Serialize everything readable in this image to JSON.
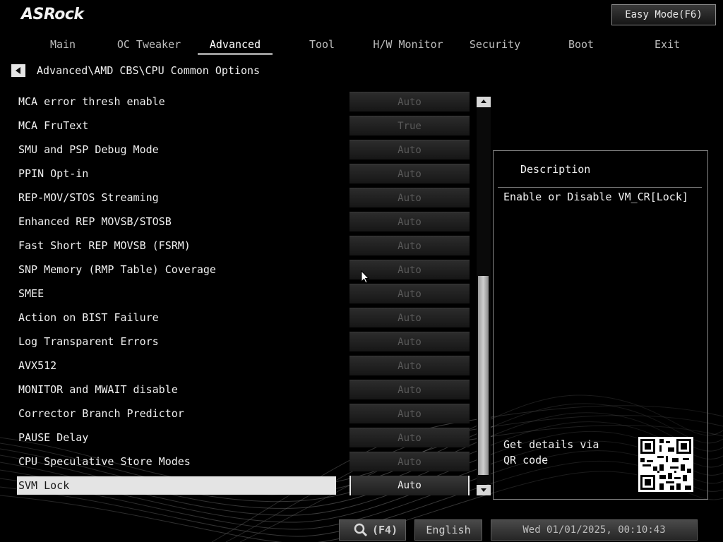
{
  "brand": {
    "logo": "ASRock"
  },
  "header": {
    "easy_mode": "Easy Mode(F6)"
  },
  "tabs": [
    {
      "label": "Main"
    },
    {
      "label": "OC Tweaker"
    },
    {
      "label": "Advanced",
      "active": true
    },
    {
      "label": "Tool"
    },
    {
      "label": "H/W Monitor"
    },
    {
      "label": "Security"
    },
    {
      "label": "Boot"
    },
    {
      "label": "Exit"
    }
  ],
  "breadcrumb": "Advanced\\AMD CBS\\CPU Common Options",
  "settings": [
    {
      "label": "MCA error thresh enable",
      "value": "Auto"
    },
    {
      "label": "MCA FruText",
      "value": "True"
    },
    {
      "label": "SMU and PSP Debug Mode",
      "value": "Auto"
    },
    {
      "label": "PPIN Opt-in",
      "value": "Auto"
    },
    {
      "label": "REP-MOV/STOS Streaming",
      "value": "Auto"
    },
    {
      "label": "Enhanced REP MOVSB/STOSB",
      "value": "Auto"
    },
    {
      "label": "Fast Short REP MOVSB (FSRM)",
      "value": "Auto"
    },
    {
      "label": "SNP Memory (RMP Table) Coverage",
      "value": "Auto"
    },
    {
      "label": "SMEE",
      "value": "Auto"
    },
    {
      "label": "Action on BIST Failure",
      "value": "Auto"
    },
    {
      "label": "Log Transparent Errors",
      "value": "Auto"
    },
    {
      "label": "AVX512",
      "value": "Auto"
    },
    {
      "label": "MONITOR and MWAIT disable",
      "value": "Auto"
    },
    {
      "label": "Corrector Branch Predictor",
      "value": "Auto"
    },
    {
      "label": "PAUSE Delay",
      "value": "Auto"
    },
    {
      "label": "CPU Speculative Store Modes",
      "value": "Auto"
    },
    {
      "label": "SVM Lock",
      "value": "Auto",
      "selected": true
    }
  ],
  "description": {
    "title": "Description",
    "text": "Enable or Disable VM_CR[Lock]",
    "qr_text": "Get details via QR code"
  },
  "footer": {
    "search_key": "(F4)",
    "language": "English",
    "datetime": "Wed 01/01/2025, 00:10:43"
  },
  "colors": {
    "background": "#000000",
    "selected_row": "#e4e4e4",
    "inactive_value_text": "#5a5a5a"
  },
  "icons": {
    "back": "left-triangle-icon",
    "search": "magnifier-icon",
    "scroll_up": "up-triangle-icon",
    "scroll_down": "down-triangle-icon"
  }
}
